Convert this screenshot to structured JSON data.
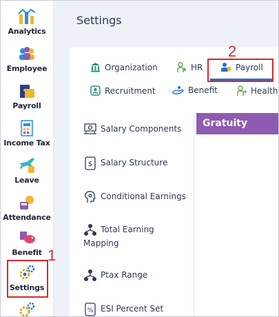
{
  "nav": {
    "items": [
      {
        "label": "Analytics"
      },
      {
        "label": "Employee"
      },
      {
        "label": "Payroll"
      },
      {
        "label": "Income Tax"
      },
      {
        "label": "Leave"
      },
      {
        "label": "Attendance"
      },
      {
        "label": "Benefit"
      },
      {
        "label": "Settings"
      }
    ]
  },
  "page": {
    "title": "Settings"
  },
  "tabs": [
    {
      "label": "Organization"
    },
    {
      "label": "HR"
    },
    {
      "label": "Payroll",
      "active": true
    },
    {
      "label": "Recruitment"
    },
    {
      "label": "Benefit"
    },
    {
      "label": "Health"
    }
  ],
  "payroll_menu": [
    {
      "label": "Salary Components"
    },
    {
      "label": "Salary Structure"
    },
    {
      "label": "Conditional Earnings"
    },
    {
      "label": "Total Earning",
      "label2": "Mapping"
    },
    {
      "label": "Ptax Range"
    },
    {
      "label": "ESI Percent Set"
    }
  ],
  "panel": {
    "header": "Gratuity",
    "header_color": "#8e5bb2"
  },
  "annotations": {
    "marker1": "1",
    "marker2": "2",
    "color": "#d9262c"
  }
}
